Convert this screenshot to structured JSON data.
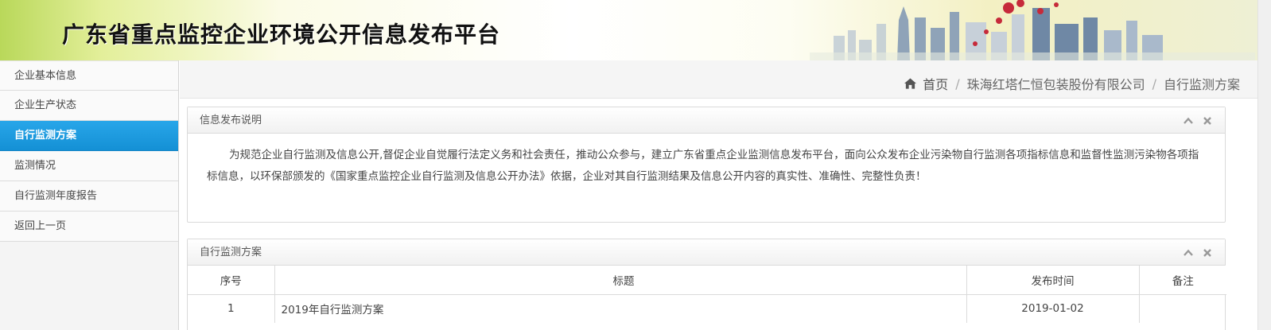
{
  "header": {
    "title": "广东省重点监控企业环境公开信息发布平台"
  },
  "sidebar": {
    "items": [
      {
        "label": "企业基本信息",
        "active": false
      },
      {
        "label": "企业生产状态",
        "active": false
      },
      {
        "label": "自行监测方案",
        "active": true
      },
      {
        "label": "监测情况",
        "active": false
      },
      {
        "label": "自行监测年度报告",
        "active": false
      },
      {
        "label": "返回上一页",
        "active": false
      }
    ]
  },
  "breadcrumb": {
    "home": "首页",
    "company": "珠海红塔仁恒包装股份有限公司",
    "current": "自行监测方案",
    "separator": "/"
  },
  "info_panel": {
    "title": "信息发布说明",
    "body": "为规范企业自行监测及信息公开,督促企业自觉履行法定义务和社会责任，推动公众参与，建立广东省重点企业监测信息发布平台，面向公众发布企业污染物自行监测各项指标信息和监督性监测污染物各项指标信息，以环保部颁发的《国家重点监控企业自行监测及信息公开办法》依据，企业对其自行监测结果及信息公开内容的真实性、准确性、完整性负责！"
  },
  "plan_panel": {
    "title": "自行监测方案",
    "columns": [
      "序号",
      "标题",
      "发布时间",
      "备注"
    ],
    "rows": [
      {
        "index": "1",
        "title": "2019年自行监测方案",
        "date": "2019-01-02",
        "note": ""
      }
    ]
  },
  "icons": {
    "home": "home-icon",
    "collapse": "chevron-up-icon",
    "close": "close-icon"
  },
  "colors": {
    "accent": "#1a9be0",
    "panel_border": "#dadada"
  }
}
